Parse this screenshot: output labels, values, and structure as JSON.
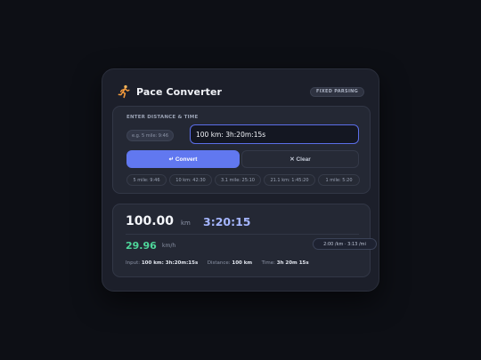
{
  "header": {
    "title": "Pace Converter",
    "badge": "FIXED PARSING",
    "logo_icon": "runner-icon"
  },
  "input_panel": {
    "label": "ENTER DISTANCE & TIME",
    "hint": "e.g. 5 mile: 9:46",
    "value": "100 km: 3h:20m:15s",
    "convert_label": "↵ Convert",
    "clear_label": "✕ Clear",
    "presets": [
      "5 mile: 9:46",
      "10 km: 42:30",
      "3.1 mile: 25:10",
      "21.1 km: 1:45:20",
      "1 mile: 5:20"
    ]
  },
  "result": {
    "distance_value": "100.00",
    "distance_unit": "km",
    "time": "3:20:15",
    "speed_value": "29.96",
    "speed_unit": "km/h",
    "pace": "2:00 /km · 3:13 /mi",
    "meta": {
      "input_label": "Input:",
      "input_value": "100 km: 3h:20m:15s",
      "distance_label": "Distance:",
      "distance_value": "100 km",
      "time_label": "Time:",
      "time_value": "3h 20m 15s"
    }
  },
  "colors": {
    "accent": "#6178f0",
    "speed": "#4ed69a",
    "time": "#a5b6ff",
    "background": "#0d0f15",
    "card": "#1c1f2a"
  }
}
